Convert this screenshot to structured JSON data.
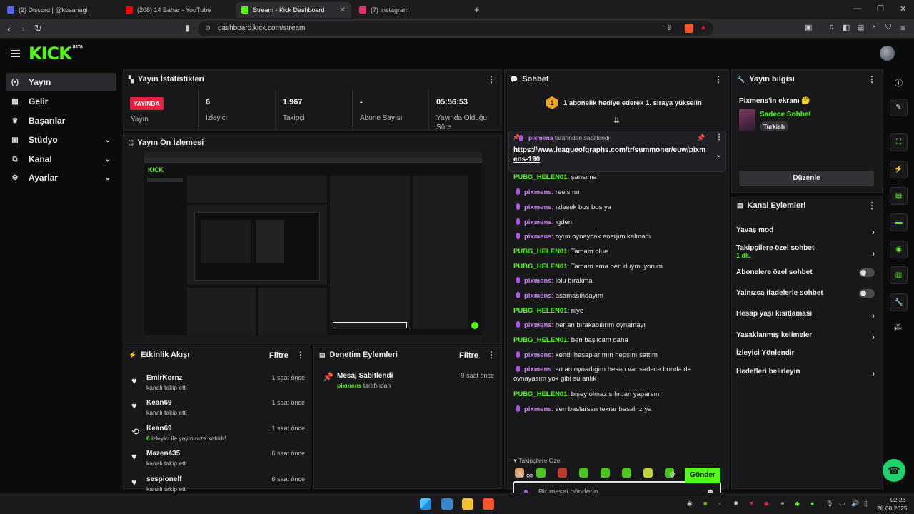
{
  "browser": {
    "tabs": [
      {
        "label": "(2) Discord | @kusanagi",
        "color": "#5865f2"
      },
      {
        "label": "(208) 14 Bahar - YouTube",
        "color": "#ff0000"
      },
      {
        "label": "Stream - Kick Dashboard",
        "color": "#53fc18"
      },
      {
        "label": "(7) Instagram",
        "color": "#e1306c"
      }
    ],
    "url": "dashboard.kick.com/stream"
  },
  "header": {
    "logo": "KICK",
    "logo_badge": "BETA"
  },
  "sidebar": {
    "items": [
      {
        "label": "Yayın",
        "icon": "(•)"
      },
      {
        "label": "Gelir",
        "icon": "▦"
      },
      {
        "label": "Başarılar",
        "icon": "♛"
      },
      {
        "label": "Stüdyo",
        "icon": "▣"
      },
      {
        "label": "Kanal",
        "icon": "⧉"
      },
      {
        "label": "Ayarlar",
        "icon": "⚙"
      }
    ]
  },
  "stats": {
    "title": "Yayın İstatistikleri",
    "live_badge": "YAYINDA",
    "live_label": "Yayın",
    "viewers": "6",
    "viewers_label": "İzleyici",
    "followers": "1.967",
    "followers_label": "Takipçi",
    "subs": "-",
    "subs_label": "Abone Sayısı",
    "duration": "05:56:53",
    "duration_label": "Yayında Olduğu Süre"
  },
  "preview": {
    "title": "Yayın Ön İzlemesi"
  },
  "activity": {
    "title": "Etkinlik Akışı",
    "filter": "Filtre",
    "items": [
      {
        "name": "EmirKornz",
        "sub": "kanalı takip etti",
        "time": "1 saat önce",
        "icon": "♥"
      },
      {
        "name": "Kean69",
        "sub": "kanalı takip etti",
        "time": "1 saat önce",
        "icon": "♥"
      },
      {
        "name": "Kean69",
        "count": "6",
        "sub": "izleyici ile yayınınıza katıldı!",
        "time": "1 saat önce",
        "icon": "⟲"
      },
      {
        "name": "Mazen435",
        "sub": "kanalı takip etti",
        "time": "6 saat önce",
        "icon": "♥"
      },
      {
        "name": "sespionelf",
        "sub": "kanalı takip etti",
        "time": "6 saat önce",
        "icon": "♥"
      }
    ]
  },
  "moderation": {
    "title": "Denetim Eylemleri",
    "filter": "Filtre",
    "item_title": "Mesaj Sabitlendi",
    "item_user": "pixmens",
    "item_suffix": "tarafından",
    "item_time": "9 saat önce"
  },
  "chat": {
    "title": "Sohbet",
    "gift_rank": "1",
    "gift_text": "1 abonelik hediye ederek 1. sıraya yükselin",
    "pinned_by": "pixmens",
    "pinned_suffix": "tarafından sabitlendi",
    "pinned_link": "https://www.leagueofgraphs.com/tr/summoner/euw/pixmens-190",
    "messages": [
      {
        "user": "PUBG_HELEN01",
        "text": "şansıma",
        "kind": "pub"
      },
      {
        "user": "pixmens",
        "text": "reels mı",
        "kind": "pix"
      },
      {
        "user": "pixmens",
        "text": "ızlesek bos bos ya",
        "kind": "pix"
      },
      {
        "user": "pixmens",
        "text": "igden",
        "kind": "pix"
      },
      {
        "user": "pixmens",
        "text": "oyun oynaycak enerjım kalmadı",
        "kind": "pix"
      },
      {
        "user": "PUBG_HELEN01",
        "text": "Tamam olue",
        "kind": "pub"
      },
      {
        "user": "PUBG_HELEN01",
        "text": "Tamam ama ben duymuyorum",
        "kind": "pub"
      },
      {
        "user": "pixmens",
        "text": "lolu bırakma",
        "kind": "pix"
      },
      {
        "user": "pixmens",
        "text": "asamasındayım",
        "kind": "pix"
      },
      {
        "user": "PUBG_HELEN01",
        "text": "niye",
        "kind": "pub"
      },
      {
        "user": "pixmens",
        "text": "her an bırakabılırım oynamayı",
        "kind": "pix"
      },
      {
        "user": "PUBG_HELEN01",
        "text": "ben başlicam daha",
        "kind": "pub"
      },
      {
        "user": "pixmens",
        "text": "kendı hesaplarımın hepsını sattım",
        "kind": "pix"
      },
      {
        "user": "pixmens",
        "text": "su an oynadıgım hesap var sadece bunda da oynayasım yok gibi su anlık",
        "kind": "pix"
      },
      {
        "user": "PUBG_HELEN01",
        "text": "bişey olmaz sıfırdan yaparsın",
        "kind": "pub"
      },
      {
        "user": "pixmens",
        "text": "sen baslarsan tekrar basalrız ya",
        "kind": "pix"
      }
    ],
    "followers_only_label": "Takipçilere Özel",
    "input_placeholder": "Bir mesaj gönderin",
    "send_label": "Gönder"
  },
  "stream_info": {
    "title": "Yayın bilgisi",
    "screen_title": "Pixmens'in ekranı 🤔",
    "category": "Sadece Sohbet",
    "tag": "Turkish",
    "edit_label": "Düzenle"
  },
  "channel_actions": {
    "title": "Kanal Eylemleri",
    "slow_mode": "Yavaş mod",
    "followers_chat": "Takipçilere özel sohbet",
    "followers_chat_sub": "1 dk.",
    "subs_chat": "Abonelere özel sohbet",
    "emote_chat": "Yalnızca ifadelerle sohbet",
    "age_limit": "Hesap yaşı kısıtlaması",
    "banned_words": "Yasaklanmış kelimeler",
    "redirect": "İzleyici Yönlendir",
    "goals": "Hedefleri belirleyin"
  },
  "taskbar": {
    "time": "02:28",
    "date": "28.08.2025"
  }
}
